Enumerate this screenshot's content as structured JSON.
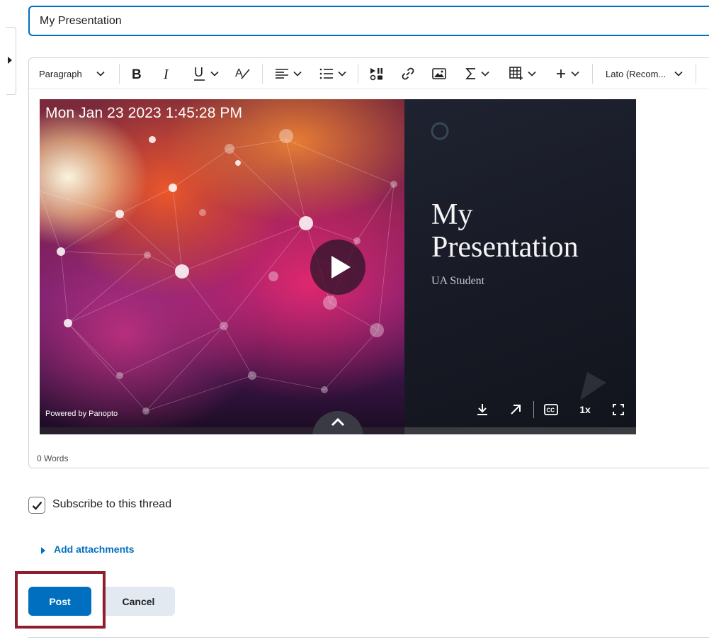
{
  "title_input": {
    "value": "My Presentation"
  },
  "toolbar": {
    "paragraph_label": "Paragraph",
    "font_label": "Lato (Recom..."
  },
  "video": {
    "timestamp": "Mon Jan 23 2023 1:45:28 PM",
    "slide_title_line1": "My",
    "slide_title_line2": "Presentation",
    "slide_subtitle": "UA Student",
    "powered_by": "Powered by Panopto",
    "speed_label": "1x"
  },
  "editor": {
    "word_count": "0 Words"
  },
  "subscribe": {
    "label": "Subscribe to this thread",
    "checked": true
  },
  "attachments": {
    "label": "Add attachments"
  },
  "actions": {
    "post_label": "Post",
    "cancel_label": "Cancel"
  },
  "colors": {
    "primary": "#006fbf",
    "highlight_box": "#8f1d2c",
    "cancel_bg": "#e3e9f1"
  }
}
